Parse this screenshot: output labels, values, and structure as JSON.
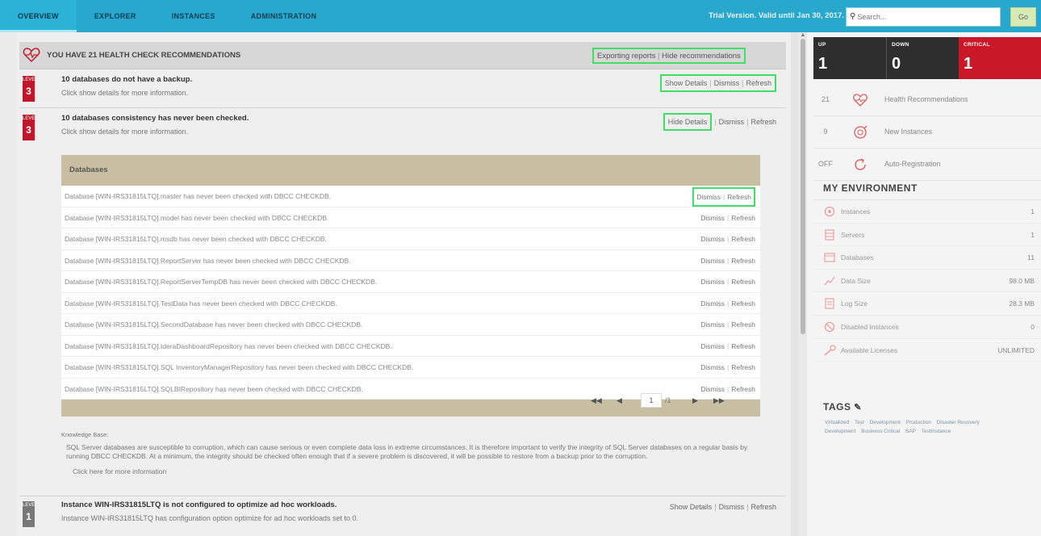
{
  "nav": {
    "tabs": [
      "OVERVIEW",
      "EXPLORER",
      "INSTANCES",
      "ADMINISTRATION"
    ],
    "trial": "Trial Version. Valid until Jan 30, 2017.",
    "search_placeholder": "Search...",
    "go_label": "Go"
  },
  "header": {
    "title": "YOU HAVE 21 HEALTH CHECK RECOMMENDATIONS",
    "link1": "Exporting reports",
    "link2": "Hide recommendations"
  },
  "recommendations": [
    {
      "level_label": "LEVEL",
      "level": "3",
      "title": "10 databases do not have a backup.",
      "subtitle": "Click show details for more information.",
      "actions": [
        "Show Details",
        "Dismiss",
        "Refresh"
      ]
    },
    {
      "level_label": "LEVEL",
      "level": "3",
      "title": "10 databases consistency has never been checked.",
      "subtitle": "Click show details for more information.",
      "actions": [
        "Hide Details",
        "Dismiss",
        "Refresh"
      ]
    },
    {
      "level_label": "LEVEL",
      "level": "1",
      "title": "Instance WIN-IRS31815LTQ is not configured to optimize ad hoc workloads.",
      "subtitle": "Instance WIN-IRS31815LTQ has configuration option optimize for ad hoc workloads set to 0.",
      "actions": [
        "Show Details",
        "Dismiss",
        "Refresh"
      ]
    }
  ],
  "dbtable": {
    "header": "Databases",
    "rows": [
      "Database [WIN-IRS31815LTQ].master has never been checked with DBCC CHECKDB.",
      "Database [WIN-IRS31815LTQ].model has never been checked with DBCC CHECKDB.",
      "Database [WIN-IRS31815LTQ].msdb has never been checked with DBCC CHECKDB.",
      "Database [WIN-IRS31815LTQ].ReportServer has never been checked with DBCC CHECKDB.",
      "Database [WIN-IRS31815LTQ].ReportServerTempDB has never been checked with DBCC CHECKDB.",
      "Database [WIN-IRS31815LTQ].TestData has never been checked with DBCC CHECKDB.",
      "Database [WIN-IRS31815LTQ].SecondDatabase has never been checked with DBCC CHECKDB.",
      "Database [WIN-IRS31815LTQ].IderaDashboardRepository has never been checked with DBCC CHECKDB.",
      "Database [WIN-IRS31815LTQ].SQL InventoryManagerRepository has never been checked with DBCC CHECKDB.",
      "Database [WIN-IRS31815LTQ].SQLBIRepository has never been checked with DBCC CHECKDB."
    ],
    "row_dismiss": "Dismiss",
    "row_refresh": "Refresh",
    "page": "1",
    "page_total": "/1"
  },
  "knowledge": {
    "label": "Knowledge Base:",
    "text": "SQL Server databases are susceptible to corruption, which can cause serious or even complete data loss in extreme circumstances. It is therefore important to verify the integrity of SQL Server databases on a regular basis by running DBCC CHECKDB. At a minimum, the integrity should be checked often enough that if a severe problem is discovered, it will be possible to restore from a backup prior to the corruption.",
    "more": "Click here for more information"
  },
  "status": {
    "up_label": "UP",
    "up": "1",
    "down_label": "DOWN",
    "down": "0",
    "crit_label": "CRITICAL",
    "crit": "1"
  },
  "summary": [
    {
      "count": "21",
      "label": "Health Recommendations",
      "icon": "heart-icon"
    },
    {
      "count": "9",
      "label": "New Instances",
      "icon": "new-instances-icon"
    },
    {
      "count": "OFF",
      "label": "Auto-Registration",
      "icon": "refresh-icon"
    }
  ],
  "environment": {
    "title": "MY ENVIRONMENT",
    "rows": [
      {
        "label": "Instances",
        "value": "1",
        "icon": "instances-icon"
      },
      {
        "label": "Servers",
        "value": "1",
        "icon": "servers-icon"
      },
      {
        "label": "Databases",
        "value": "11",
        "icon": "databases-icon"
      },
      {
        "label": "Data Size",
        "value": "98.0 MB",
        "icon": "data-size-icon"
      },
      {
        "label": "Log Size",
        "value": "28.3 MB",
        "icon": "log-size-icon"
      },
      {
        "label": "Disabled Instances",
        "value": "0",
        "icon": "disabled-icon"
      },
      {
        "label": "Available Licenses",
        "value": "UNLIMITED",
        "icon": "key-icon"
      }
    ]
  },
  "tags": {
    "title": "TAGS",
    "items": [
      "Virtualized",
      "Test",
      "Development",
      "Production",
      "Disaster Recovery",
      "Development",
      "Business Critical",
      "SAP",
      "TestInstance"
    ]
  },
  "colors": {
    "nav": "#28a8cc",
    "highlight": "#3ede67",
    "critical": "#c91828",
    "table_header": "#c8bea2"
  }
}
